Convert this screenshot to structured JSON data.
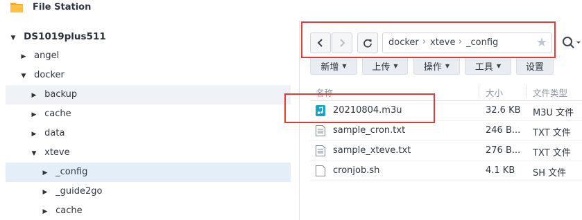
{
  "app": {
    "title": "File Station"
  },
  "tree": {
    "root": "DS1019plus511",
    "items": [
      {
        "label": "angel"
      },
      {
        "label": "docker"
      },
      {
        "label": "backup"
      },
      {
        "label": "cache"
      },
      {
        "label": "data"
      },
      {
        "label": "xteve"
      },
      {
        "label": "_config"
      },
      {
        "label": "_guide2go"
      },
      {
        "label": "cache"
      }
    ]
  },
  "nav": {
    "breadcrumb": [
      "docker",
      "xteve",
      "_config"
    ]
  },
  "toolbar": {
    "create_label": "新增",
    "upload_label": "上传",
    "action_label": "操作",
    "tools_label": "工具",
    "settings_label": "设置"
  },
  "table": {
    "columns": {
      "name": "名称",
      "size": "大小",
      "type": "文件类型"
    },
    "rows": [
      {
        "name": "20210804.m3u",
        "size": "32.6 KB",
        "type": "M3U 文件",
        "icon": "audio-file-icon"
      },
      {
        "name": "sample_cron.txt",
        "size": "246 B...",
        "type": "TXT 文件",
        "icon": "text-file-icon"
      },
      {
        "name": "sample_xteve.txt",
        "size": "276 B...",
        "type": "TXT 文件",
        "icon": "text-file-icon"
      },
      {
        "name": "cronjob.sh",
        "size": "4.1 KB",
        "type": "SH 文件",
        "icon": "generic-file-icon"
      }
    ]
  },
  "colors": {
    "highlight_box": "#e53935",
    "selected_row": "#e4eef9",
    "accent_audio": "#1ba3c6"
  }
}
